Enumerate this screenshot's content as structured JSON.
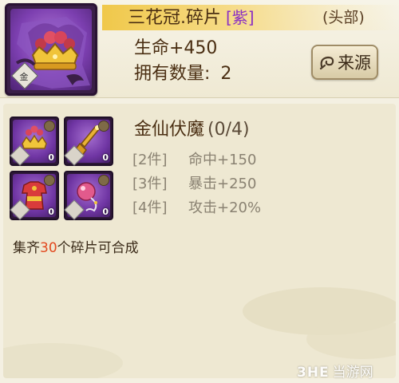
{
  "item": {
    "name": "三花冠.碎片",
    "grade": "[紫]",
    "slot": "(头部)",
    "stat": "生命+450",
    "owned_label": "拥有数量:",
    "owned_count": "2",
    "source_button": "来源",
    "grade_color": "#8a2fc4",
    "icon": "crown-fragment-icon",
    "tier_glyph": "金"
  },
  "set": {
    "name": "金仙伏魔",
    "progress": "(0/4)",
    "bonuses": [
      {
        "pieces": "[2件]",
        "effect": "命中+150"
      },
      {
        "pieces": "[3件]",
        "effect": "暴击+250"
      },
      {
        "pieces": "[4件]",
        "effect": "攻击+20%"
      }
    ],
    "fragments": [
      {
        "icon": "crown-icon",
        "count": "0"
      },
      {
        "icon": "scepter-icon",
        "count": "0"
      },
      {
        "icon": "robe-icon",
        "count": "0"
      },
      {
        "icon": "orb-necklace-icon",
        "count": "0"
      }
    ]
  },
  "collect": {
    "prefix": "集齐",
    "number": "30",
    "suffix": "个碎片可合成",
    "number_color": "#e2491f"
  },
  "watermark": {
    "brand": "3HE",
    "text": "当游网"
  }
}
